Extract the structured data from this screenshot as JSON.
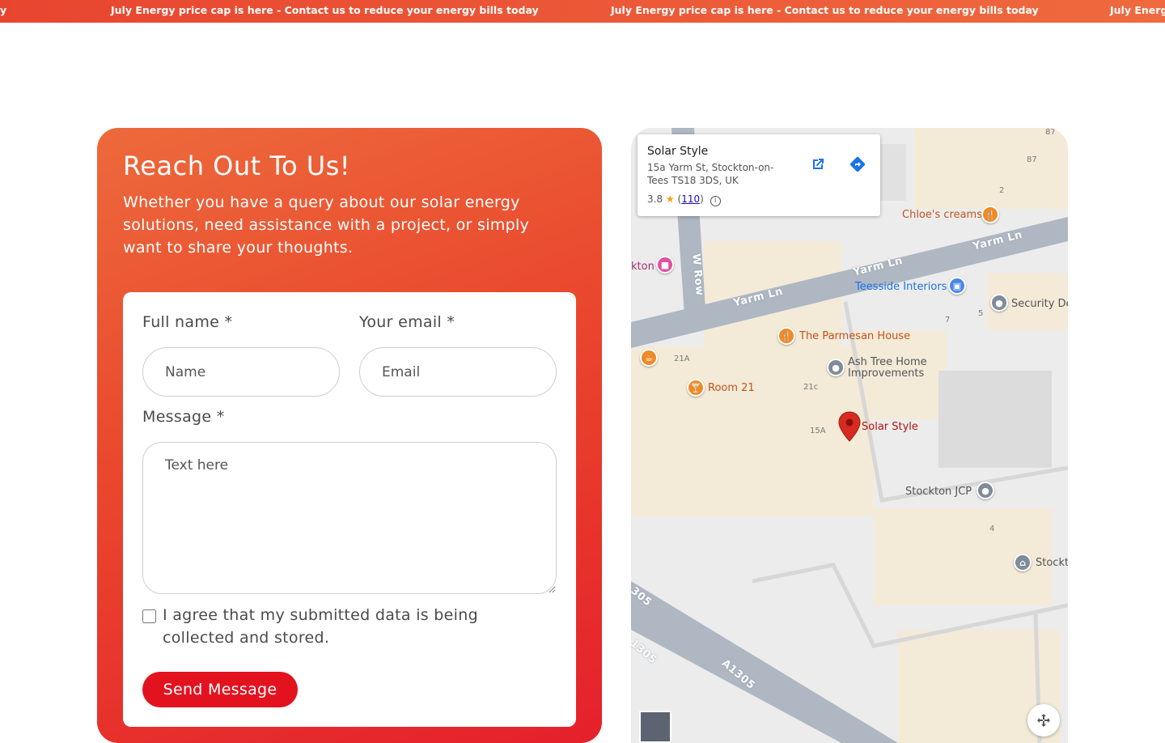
{
  "ticker": {
    "message": "July Energy price cap is here - Contact us to reduce your energy bills today",
    "partial_left": "y",
    "partial_right": "July Energy"
  },
  "contact": {
    "title": "Reach Out To Us!",
    "intro": "Whether you have a query about our solar energy solutions, need assistance with a project, or simply want to share your thoughts.",
    "form": {
      "full_name_label": "Full name *",
      "full_name_placeholder": "Name",
      "email_label": "Your email *",
      "email_placeholder": "Email",
      "message_label": "Message *",
      "message_placeholder": "Text here",
      "consent_label": "I agree that my submitted data is being collected and stored.",
      "consent_checked": false,
      "submit_label": "Send Message"
    },
    "colors": {
      "card_gradient_top": "#ec6a3c",
      "card_gradient_bottom": "#e5202b",
      "button": "#e3121f"
    }
  },
  "map": {
    "info": {
      "name": "Solar Style",
      "address": "15a Yarm St, Stockton-on-Tees TS18 3DS, UK",
      "rating": "3.8",
      "reviews": "110",
      "open_icon": "open-in-new-icon",
      "directions_icon": "directions-icon"
    },
    "streets": {
      "yarm_ln": "Yarm Ln",
      "w_row": "W Row",
      "a1305": "A1305",
      "a1305_partial_a": "305",
      "a1305_partial_b": "1305"
    },
    "pois": {
      "chloes": "Chloe's creams",
      "kton": "kton",
      "teesside": "Teesside Interiors",
      "security": "Security De",
      "parmesan": "The Parmesan House",
      "ash_tree": "Ash Tree Home Improvements",
      "room21": "Room 21",
      "solar": "Solar Style",
      "jcp": "Stockton JCP",
      "stockt": "Stockt"
    },
    "numbers": {
      "n87a": "87",
      "n87b": "87",
      "n2": "2",
      "n7": "7",
      "n5": "5",
      "n21a": "21A",
      "n21c": "21c",
      "n15a": "15A",
      "n4": "4"
    }
  }
}
